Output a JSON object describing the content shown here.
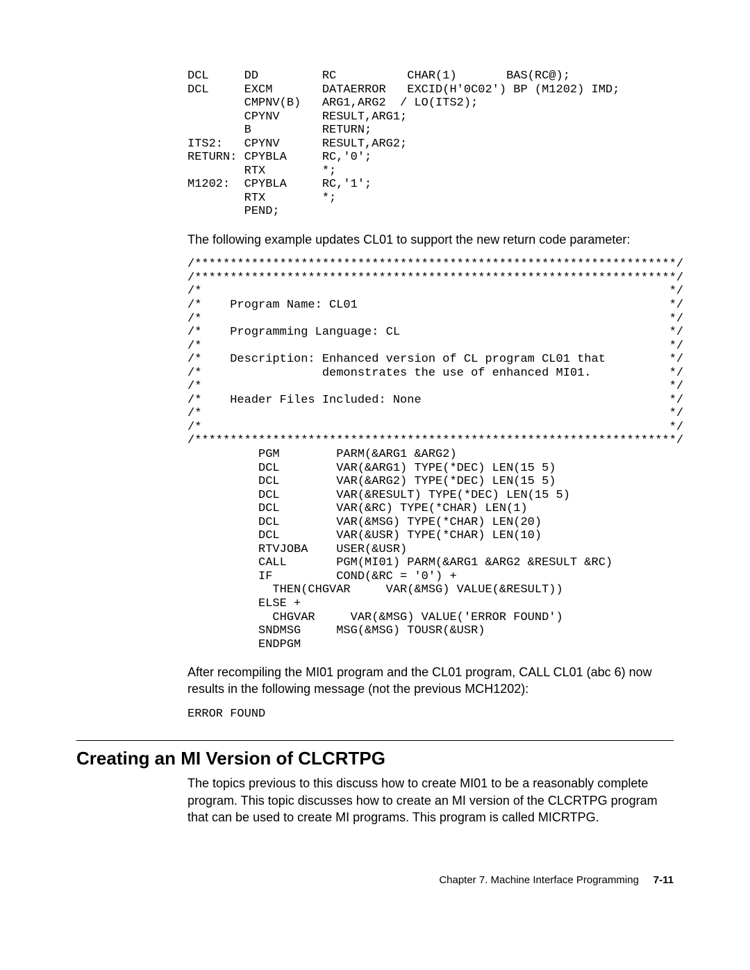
{
  "code_block_1": "DCL     DD         RC          CHAR(1)       BAS(RC@);\nDCL     EXCM       DATAERROR   EXCID(H'0C02') BP (M1202) IMD;\n        CMPNV(B)   ARG1,ARG2  / LO(ITS2);\n        CPYNV      RESULT,ARG1;\n        B          RETURN;\nITS2:   CPYNV      RESULT,ARG2;\nRETURN: CPYBLA     RC,'0';\n        RTX        *;\nM1202:  CPYBLA     RC,'1';\n        RTX        *;\n        PEND;",
  "para_1": "The following example updates CL01 to support the new return code parameter:",
  "code_block_2": "/********************************************************************/\n/********************************************************************/\n/*                                                                  */\n/*    Program Name: CL01                                            */\n/*                                                                  */\n/*    Programming Language: CL                                      */\n/*                                                                  */\n/*    Description: Enhanced version of CL program CL01 that         */\n/*                 demonstrates the use of enhanced MI01.           */\n/*                                                                  */\n/*    Header Files Included: None                                   */\n/*                                                                  */\n/*                                                                  */\n/********************************************************************/\n          PGM        PARM(&ARG1 &ARG2)\n          DCL        VAR(&ARG1) TYPE(*DEC) LEN(15 5)\n          DCL        VAR(&ARG2) TYPE(*DEC) LEN(15 5)\n          DCL        VAR(&RESULT) TYPE(*DEC) LEN(15 5)\n          DCL        VAR(&RC) TYPE(*CHAR) LEN(1)\n          DCL        VAR(&MSG) TYPE(*CHAR) LEN(20)\n          DCL        VAR(&USR) TYPE(*CHAR) LEN(10)\n          RTVJOBA    USER(&USR)\n          CALL       PGM(MI01) PARM(&ARG1 &ARG2 &RESULT &RC)\n          IF         COND(&RC = '0') +\n            THEN(CHGVAR     VAR(&MSG) VALUE(&RESULT))\n          ELSE +\n            CHGVAR     VAR(&MSG) VALUE('ERROR FOUND')\n          SNDMSG     MSG(&MSG) TOUSR(&USR)\n          ENDPGM",
  "para_2": "After recompiling the MI01 program and the CL01 program, CALL CL01 (abc   6) now results in the following message (not the previous MCH1202):",
  "code_block_3": "ERROR FOUND",
  "heading": "Creating an MI Version of CLCRTPG",
  "para_3": "The topics previous to this discuss how to create MI01 to be a reasonably complete program.  This topic discusses how to create an MI version of the CLCRTPG program that can be used to create MI programs.  This program is called MICRTPG.",
  "footer_chapter": "Chapter 7.  Machine Interface Programming",
  "footer_page": "7-11"
}
